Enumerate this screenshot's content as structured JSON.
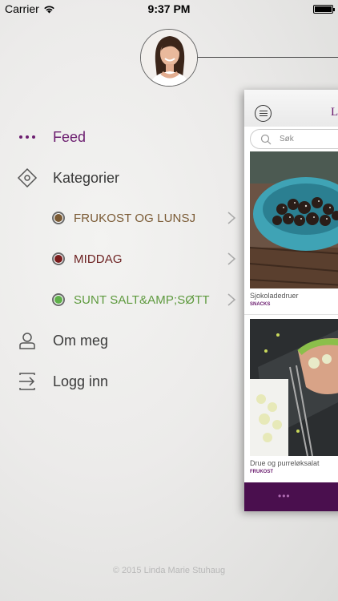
{
  "status_bar": {
    "carrier": "Carrier",
    "time": "9:37 PM",
    "battery_percent": 100
  },
  "profile": {
    "avatar_icon": "profile-photo"
  },
  "menu": {
    "feed": {
      "label": "Feed",
      "icon": "ellipsis-icon",
      "active": true
    },
    "categories": {
      "label": "Kategorier",
      "icon": "diamond-icon"
    },
    "sub_items": [
      {
        "label": "FRUKOST OG LUNSJ",
        "color": "#7a5a34",
        "dot": "#7a5a34"
      },
      {
        "label": "MIDDAG",
        "color": "#6b1f1f",
        "dot": "#7a1c1c"
      },
      {
        "label": "SUNT SALT&AMP;SØTT",
        "color": "#5e9a3e",
        "dot": "#5fb04a"
      }
    ],
    "about": {
      "label": "Om meg",
      "icon": "person-icon"
    },
    "login": {
      "label": "Logg inn",
      "icon": "login-arrow-icon"
    }
  },
  "footer": {
    "copyright": "© 2015 Linda Marie Stuhaug"
  },
  "preview": {
    "logo_text": "LI",
    "search_placeholder": "Søk",
    "posts": [
      {
        "title": "Sjokoladedruer",
        "tag": "SNACKS"
      },
      {
        "title": "Drue og purreløksalat",
        "tag": "FRUKOST"
      }
    ],
    "bottom_dots": "•••"
  },
  "colors": {
    "accent": "#6b1d6f",
    "bottom_bar": "#4a0f4e"
  }
}
